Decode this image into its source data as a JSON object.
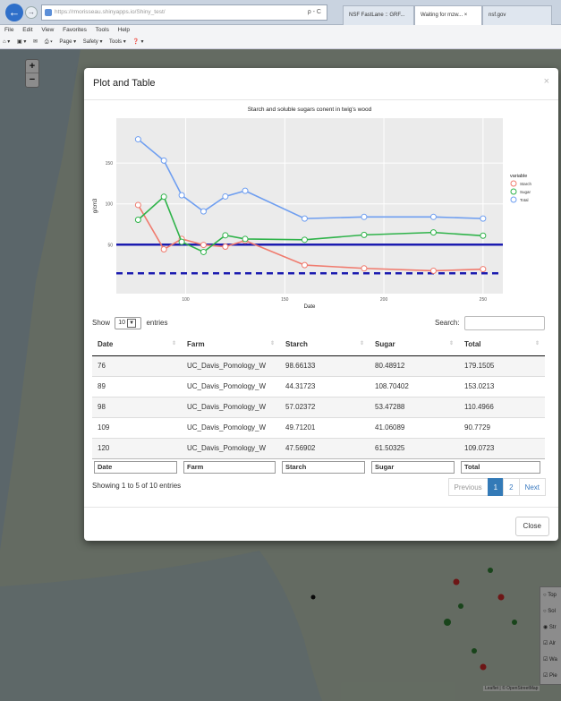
{
  "browser": {
    "url_prefix": "https://rmorisseau.shinyapps.io/Shiny_test/",
    "url_host": "shinyapps.io",
    "url_tools": "ρ - C",
    "tabs": [
      {
        "label": "NSF FastLane :: GRF..."
      },
      {
        "label": "Waiting for mzw... ×"
      },
      {
        "label": "nsf.gov"
      }
    ],
    "menu": [
      "File",
      "Edit",
      "View",
      "Favorites",
      "Tools",
      "Help"
    ],
    "commands": [
      "Page ▾",
      "Safety ▾",
      "Tools ▾"
    ]
  },
  "map": {
    "zoom_in": "+",
    "zoom_out": "−",
    "attribution": "Leaflet | © OpenStreetMap",
    "layer_labels": [
      "Top",
      "Sol",
      "Str",
      "Alr",
      "Wa",
      "Pie"
    ]
  },
  "modal": {
    "title": "Plot and Table",
    "close_x": "×",
    "show_label": "Show",
    "entries_value": "10",
    "entries_label": "entries",
    "search_label": "Search:",
    "table": {
      "headers": [
        "Date",
        "Farm",
        "Starch",
        "Sugar",
        "Total"
      ],
      "rows": [
        [
          "76",
          "UC_Davis_Pomology_W",
          "98.66133",
          "80.48912",
          "179.1505"
        ],
        [
          "89",
          "UC_Davis_Pomology_W",
          "44.31723",
          "108.70402",
          "153.0213"
        ],
        [
          "98",
          "UC_Davis_Pomology_W",
          "57.02372",
          "53.47288",
          "110.4966"
        ],
        [
          "109",
          "UC_Davis_Pomology_W",
          "49.71201",
          "41.06089",
          "90.7729"
        ],
        [
          "120",
          "UC_Davis_Pomology_W",
          "47.56902",
          "61.50325",
          "109.0723"
        ]
      ],
      "footers": [
        "Date",
        "Farm",
        "Starch",
        "Sugar",
        "Total"
      ]
    },
    "info": "Showing 1 to 5 of 10 entries",
    "pagination": [
      "Previous",
      "1",
      "2",
      "Next"
    ],
    "close_button": "Close"
  },
  "chart_data": {
    "type": "line",
    "title": "Starch and soluble sugars conent in twig's wood",
    "xlabel": "Date",
    "ylabel": "g/cm3",
    "xlim": [
      65,
      260
    ],
    "ylim": [
      -10,
      205
    ],
    "xticks": [
      100,
      150,
      200,
      250
    ],
    "yticks": [
      50,
      100,
      150
    ],
    "legend_title": "variable",
    "legend_position": "right",
    "series": [
      {
        "name": "Starch",
        "color": "#f07b6e",
        "x": [
          76,
          89,
          98,
          109,
          120,
          130,
          160,
          190,
          225,
          250
        ],
        "y": [
          98.66,
          44.32,
          57.02,
          49.71,
          47.57,
          55,
          25,
          21,
          18,
          20
        ]
      },
      {
        "name": "Sugar",
        "color": "#2fb34a",
        "x": [
          76,
          89,
          98,
          109,
          120,
          130,
          160,
          190,
          225,
          250
        ],
        "y": [
          80.49,
          108.7,
          53.47,
          41.06,
          61.5,
          57,
          56,
          62,
          65,
          61
        ]
      },
      {
        "name": "Total",
        "color": "#6e9ef0",
        "x": [
          76,
          89,
          98,
          109,
          120,
          130,
          160,
          190,
          225,
          250
        ],
        "y": [
          179.15,
          153.02,
          110.5,
          90.77,
          109.07,
          116,
          82,
          84,
          84,
          82
        ]
      }
    ],
    "hlines": [
      {
        "y": 50,
        "color": "#1c1cb0",
        "style": "solid"
      },
      {
        "y": 15,
        "color": "#1c1cb0",
        "style": "dashed"
      }
    ],
    "grid": true
  }
}
